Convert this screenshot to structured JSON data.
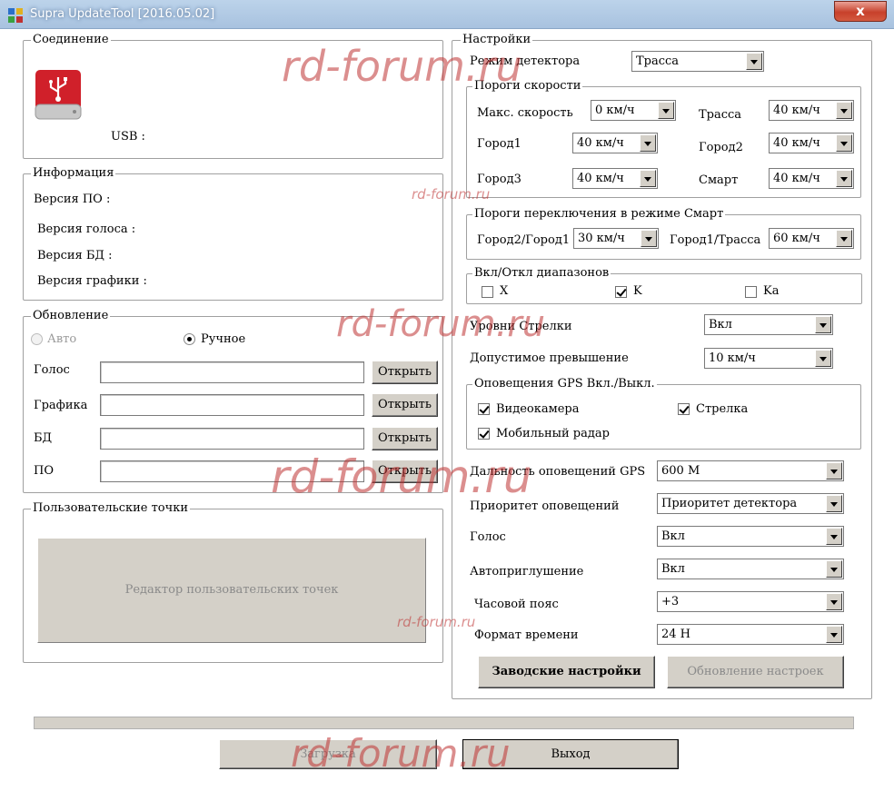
{
  "window": {
    "title": "Supra UpdateTool [2016.05.02]",
    "close_label": "x"
  },
  "connection": {
    "title": "Соединение",
    "usb_label": "USB :"
  },
  "info": {
    "title": "Информация",
    "fw_version": "Версия ПО :",
    "voice_version": "Версия голоса :",
    "db_version": "Версия БД :",
    "graphics_version": "Версия графики :"
  },
  "update": {
    "title": "Обновление",
    "mode_auto": "Авто",
    "mode_manual": "Ручное",
    "rows": [
      {
        "label": "Голос",
        "value": "",
        "button": "Открыть"
      },
      {
        "label": "Графика",
        "value": "",
        "button": "Открыть"
      },
      {
        "label": "БД",
        "value": "",
        "button": "Открыть"
      },
      {
        "label": "ПО",
        "value": "",
        "button": "Открыть"
      }
    ]
  },
  "user_points": {
    "title": "Пользовательские точки",
    "editor_button": "Редактор пользовательских точек"
  },
  "settings": {
    "title": "Настройки",
    "detector_mode": {
      "label": "Режим детектора",
      "value": "Трасса"
    },
    "speed_thresholds": {
      "title": "Пороги скорости",
      "max_speed": {
        "label": "Макс. скорость",
        "value": "0 км/ч"
      },
      "highway": {
        "label": "Трасса",
        "value": "40 км/ч"
      },
      "city1": {
        "label": "Город1",
        "value": "40 км/ч"
      },
      "city2": {
        "label": "Город2",
        "value": "40 км/ч"
      },
      "city3": {
        "label": "Город3",
        "value": "40 км/ч"
      },
      "smart": {
        "label": "Смарт",
        "value": "40 км/ч"
      }
    },
    "smart_thresholds": {
      "title": "Пороги переключения в режиме Смарт",
      "city2_city1": {
        "label": "Город2/Город1",
        "value": "30 км/ч"
      },
      "city1_highway": {
        "label": "Город1/Трасса",
        "value": "60 км/ч"
      }
    },
    "bands": {
      "title": "Вкл/Откл диапазонов",
      "x": {
        "label": "X",
        "checked": false
      },
      "k": {
        "label": "K",
        "checked": true
      },
      "ka": {
        "label": "Ka",
        "checked": false
      }
    },
    "arrow_levels": {
      "label": "Уровни Стрелки",
      "value": "Вкл"
    },
    "allowed_excess": {
      "label": "Допустимое превышение",
      "value": "10 км/ч"
    },
    "gps_alerts": {
      "title": "Оповещения GPS Вкл./Выкл.",
      "camera": {
        "label": "Видеокамера",
        "checked": true
      },
      "strelka": {
        "label": "Стрелка",
        "checked": true
      },
      "mobile_radar": {
        "label": "Мобильный радар",
        "checked": true
      }
    },
    "gps_distance": {
      "label": "Дальность оповещений GPS",
      "value": "600 M"
    },
    "alert_priority": {
      "label": "Приоритет оповещений",
      "value": "Приоритет детектора"
    },
    "voice": {
      "label": "Голос",
      "value": "Вкл"
    },
    "auto_mute": {
      "label": "Автоприглушение",
      "value": "Вкл"
    },
    "timezone": {
      "label": "Часовой пояс",
      "value": "+3"
    },
    "time_format": {
      "label": "Формат времени",
      "value": "24 H"
    },
    "factory_button": "Заводские настройки",
    "update_settings_button": "Обновление настроек"
  },
  "footer": {
    "load_button": "Загрузка",
    "exit_button": "Выход",
    "progress": 0
  },
  "watermark": "rd-forum.ru",
  "colors": {
    "usb_red": "#d0202a",
    "close_red": "#c7402b",
    "watermark": "#be3232"
  }
}
